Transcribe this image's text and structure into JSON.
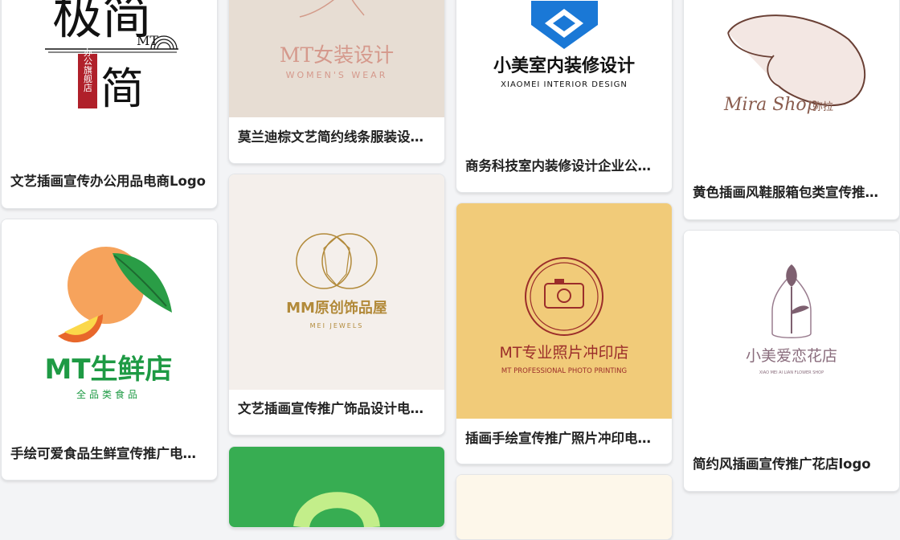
{
  "cards": [
    {
      "title": "文艺插画宣传办公用品电商Logo",
      "logo": {
        "brand": "极简",
        "latin": "MT",
        "seal": "办公旗舰店"
      },
      "icon": "circle-stripes-icon"
    },
    {
      "title": "莫兰迪棕文艺简约线条服装设计logo",
      "logo": {
        "brand": "MT女装设计",
        "tagline": "WOMEN'S WEAR"
      },
      "icon": "figure-line-icon"
    },
    {
      "title": "商务科技室内装修设计企业公司logo",
      "logo": {
        "brand": "小美室内装修设计",
        "tagline": "XIAOMEI INTERIOR DESIGN"
      },
      "icon": "blue-cube-icon"
    },
    {
      "title": "黄色插画风鞋服箱包类宣传推广logo",
      "logo": {
        "script": "Mira Shop",
        "cn": "弥拉"
      },
      "icon": "woman-hat-icon"
    },
    {
      "title": "手绘可爱食品生鲜宣传推广电商logo",
      "logo": {
        "brand": "MT生鲜店",
        "tagline": "全品类食品"
      },
      "icon": "orange-fruit-icon"
    },
    {
      "title": "文艺插画宣传推广饰品设计电商logo",
      "logo": {
        "brand": "MM原创饰品屋",
        "tagline": "MEI JEWELS"
      },
      "icon": "diamond-rings-icon"
    },
    {
      "title": "插画手绘宣传推广照片冲印电商logo",
      "logo": {
        "brand": "MT专业照片冲印店",
        "tagline": "MT PROFESSIONAL PHOTO PRINTING"
      },
      "icon": "camera-badge-icon"
    },
    {
      "title": "简约风插画宣传推广花店logo",
      "logo": {
        "brand": "小美爱恋花店",
        "tagline": "XIAO MEI AI LIAN FLOWER SHOP"
      },
      "icon": "tulip-icon"
    },
    {
      "icon": "green-shape-icon"
    },
    {
      "icon": "cream-thumb-icon"
    }
  ],
  "colors": {
    "card_bg": "#ffffff",
    "page_bg": "#f3f4f6",
    "morandi_bg": "#e7ddd3",
    "jewel_bg": "#f4efeb",
    "photo_bg": "#f1cb79",
    "green_bg": "#37ad52",
    "gold": "#b28a3a",
    "red": "#b0202a",
    "blue": "#1a78d6",
    "fresh_green": "#1e9a44"
  }
}
